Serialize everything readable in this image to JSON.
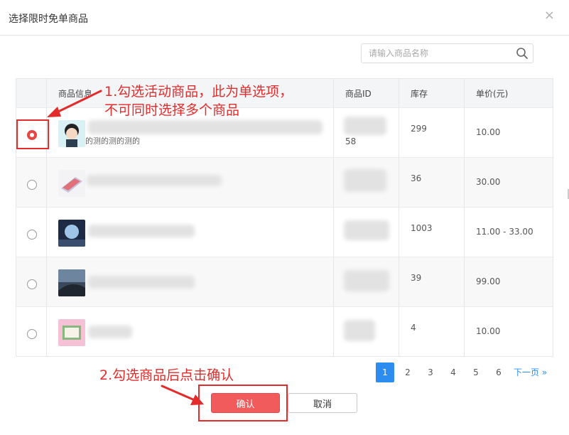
{
  "dialog": {
    "title": "选择限时免单商品",
    "close_glyph": "×"
  },
  "search": {
    "placeholder": "请输入商品名称",
    "value": ""
  },
  "table": {
    "headers": [
      "",
      "商品信息",
      "商品ID",
      "库存",
      "单价(元)"
    ],
    "rows": [
      {
        "selected": true,
        "desc": "的测的测的测的",
        "id_suffix": "58",
        "stock": "299",
        "price": "10.00"
      },
      {
        "selected": false,
        "desc": "",
        "id_suffix": "",
        "stock": "36",
        "price": "30.00"
      },
      {
        "selected": false,
        "desc": "",
        "id_suffix": "",
        "stock": "1003",
        "price": "11.00 - 33.00"
      },
      {
        "selected": false,
        "desc": "",
        "id_suffix": "",
        "stock": "39",
        "price": "99.00"
      },
      {
        "selected": false,
        "desc": "",
        "id_suffix": "",
        "stock": "4",
        "price": "10.00"
      }
    ]
  },
  "pagination": {
    "pages": [
      "1",
      "2",
      "3",
      "4",
      "5",
      "6"
    ],
    "active": "1",
    "next_label": "下一页 »"
  },
  "buttons": {
    "confirm": "确认",
    "cancel": "取消"
  },
  "annotations": {
    "note1_line1": "1.勾选活动商品，此为单选项，",
    "note1_line2": "不可同时选择多个商品",
    "note2": "2.勾选商品后点击确认",
    "color": "#e32b2b"
  },
  "colors": {
    "accent": "#2d8cf0",
    "confirm": "#f25b5b",
    "radio_checked": "#e84545"
  },
  "icons": {
    "search": "search-icon",
    "close": "close-icon",
    "next": "double-chevron-right-icon"
  }
}
